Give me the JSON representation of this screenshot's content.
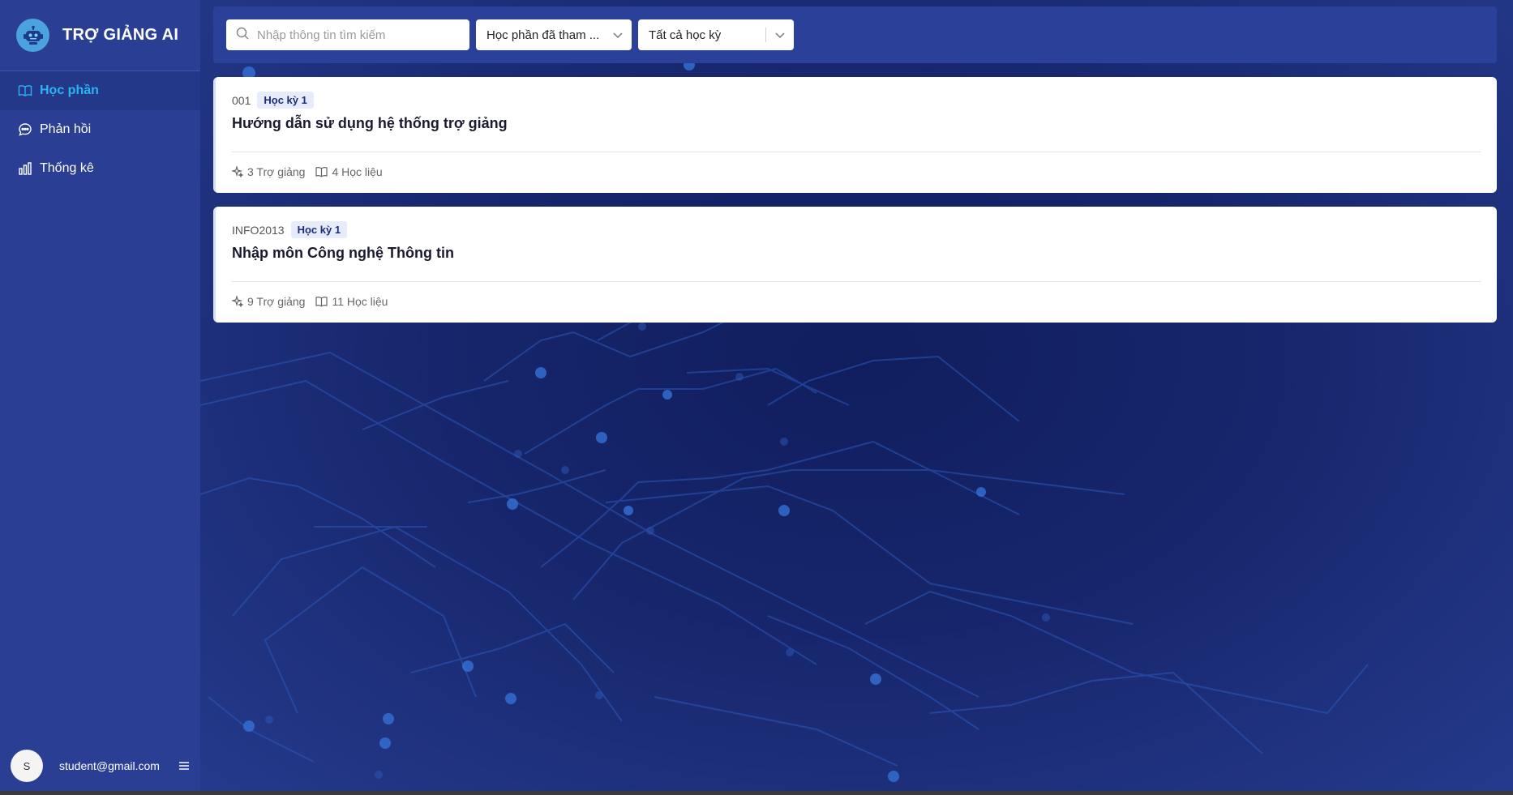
{
  "app": {
    "title": "TRỢ GIẢNG AI"
  },
  "sidebar": {
    "items": [
      {
        "label": "Học phần",
        "icon": "book-open-icon",
        "active": true
      },
      {
        "label": "Phản hồi",
        "icon": "chat-bubble-icon",
        "active": false
      },
      {
        "label": "Thống kê",
        "icon": "bar-chart-icon",
        "active": false
      }
    ],
    "user": {
      "initial": "S",
      "email": "student@gmail.com"
    }
  },
  "toolbar": {
    "search_placeholder": "Nhập thông tin tìm kiếm",
    "filter_course": "Học phần đã tham ...",
    "filter_semester": "Tất cả học kỳ"
  },
  "courses": [
    {
      "code": "001",
      "semester": "Học kỳ 1",
      "title": "Hướng dẫn sử dụng hệ thống trợ giảng",
      "assistants": "3 Trợ giảng",
      "materials": "4 Học liệu"
    },
    {
      "code": "INFO2013",
      "semester": "Học kỳ 1",
      "title": "Nhập môn Công nghệ Thông tin",
      "assistants": "9 Trợ giảng",
      "materials": "11 Học liệu"
    }
  ],
  "colors": {
    "sidebar_bg": "#2a3f94",
    "accent": "#2bb3f3",
    "badge_bg": "#e6ecfb"
  }
}
